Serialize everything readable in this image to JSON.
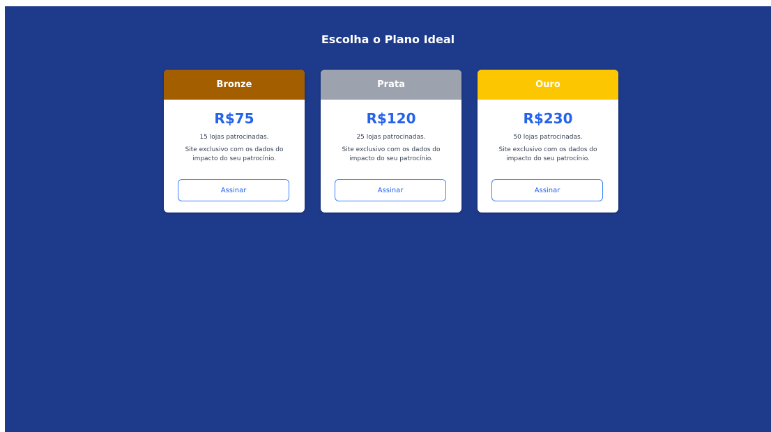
{
  "page": {
    "title": "Escolha o Plano Ideal",
    "background": "#1e3a8a"
  },
  "plans": [
    {
      "name": "Bronze",
      "header_color": "#a35e00",
      "price": "R$75",
      "stores": "15 lojas patrocinadas.",
      "feature": "Site exclusivo com os dados do impacto do seu patrocínio.",
      "button_label": "Assinar"
    },
    {
      "name": "Prata",
      "header_color": "#9ca3af",
      "price": "R$120",
      "stores": "25 lojas patrocinadas.",
      "feature": "Site exclusivo com os dados do impacto do seu patrocínio.",
      "button_label": "Assinar"
    },
    {
      "name": "Ouro",
      "header_color": "#fcc700",
      "price": "R$230",
      "stores": "50 lojas patrocinadas.",
      "feature": "Site exclusivo com os dados do impacto do seu patrocínio.",
      "button_label": "Assinar"
    }
  ]
}
